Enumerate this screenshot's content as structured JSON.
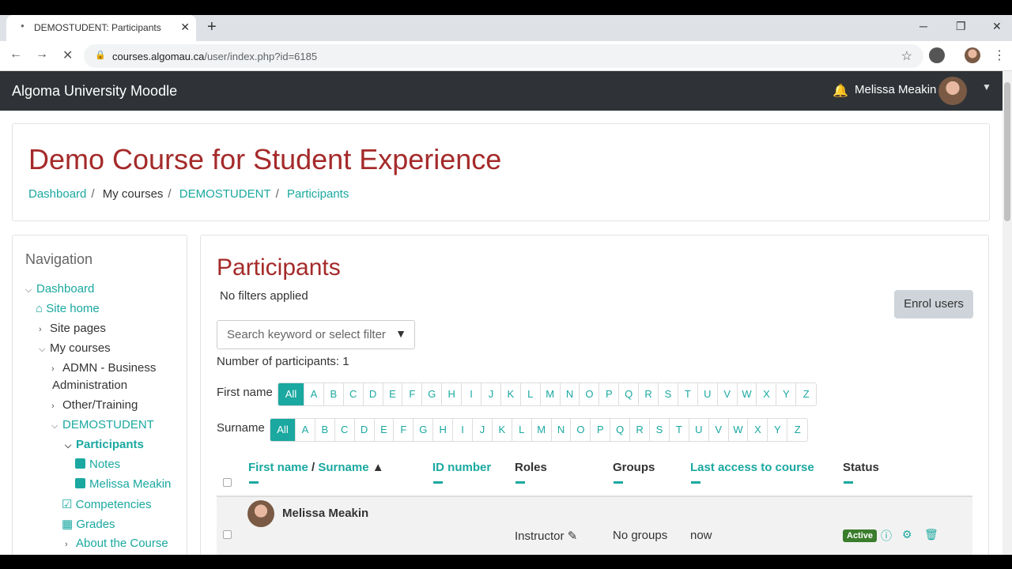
{
  "browser": {
    "tab_title": "DEMOSTUDENT: Participants",
    "url_host": "courses.algomau.ca",
    "url_path": "/user/index.php?id=6185"
  },
  "site": {
    "name": "Algoma University Moodle",
    "user_name": "Melissa Meakin"
  },
  "course": {
    "title": "Demo Course for Student Experience",
    "breadcrumb": [
      "Dashboard",
      "My courses",
      "DEMOSTUDENT",
      "Participants"
    ]
  },
  "navigation": {
    "heading": "Navigation",
    "items": [
      {
        "label": "Dashboard"
      },
      {
        "label": "Site home"
      },
      {
        "label": "Site pages"
      },
      {
        "label": "My courses"
      },
      {
        "label": "ADMN - Business"
      },
      {
        "label": "Administration"
      },
      {
        "label": "Other/Training"
      },
      {
        "label": "DEMOSTUDENT"
      },
      {
        "label": "Participants"
      },
      {
        "label": "Notes"
      },
      {
        "label": "Melissa Meakin"
      },
      {
        "label": "Competencies"
      },
      {
        "label": "Grades"
      },
      {
        "label": "About the Course"
      }
    ]
  },
  "participants": {
    "title": "Participants",
    "no_filters": "No filters applied",
    "enrol_label": "Enrol users",
    "search_placeholder": "Search keyword or select filter",
    "count_text": "Number of participants: 1",
    "first_name_label": "First name",
    "surname_label": "Surname",
    "letters": [
      "All",
      "A",
      "B",
      "C",
      "D",
      "E",
      "F",
      "G",
      "H",
      "I",
      "J",
      "K",
      "L",
      "M",
      "N",
      "O",
      "P",
      "Q",
      "R",
      "S",
      "T",
      "U",
      "V",
      "W",
      "X",
      "Y",
      "Z"
    ],
    "columns": {
      "first_name": "First name",
      "slash": "/",
      "surname": "Surname",
      "id_number": "ID number",
      "roles": "Roles",
      "groups": "Groups",
      "last_access": "Last access to course",
      "status": "Status"
    },
    "rows": [
      {
        "name": "Melissa Meakin",
        "role": "Instructor",
        "groups": "No groups",
        "last_access": "now",
        "status": "Active"
      }
    ]
  }
}
